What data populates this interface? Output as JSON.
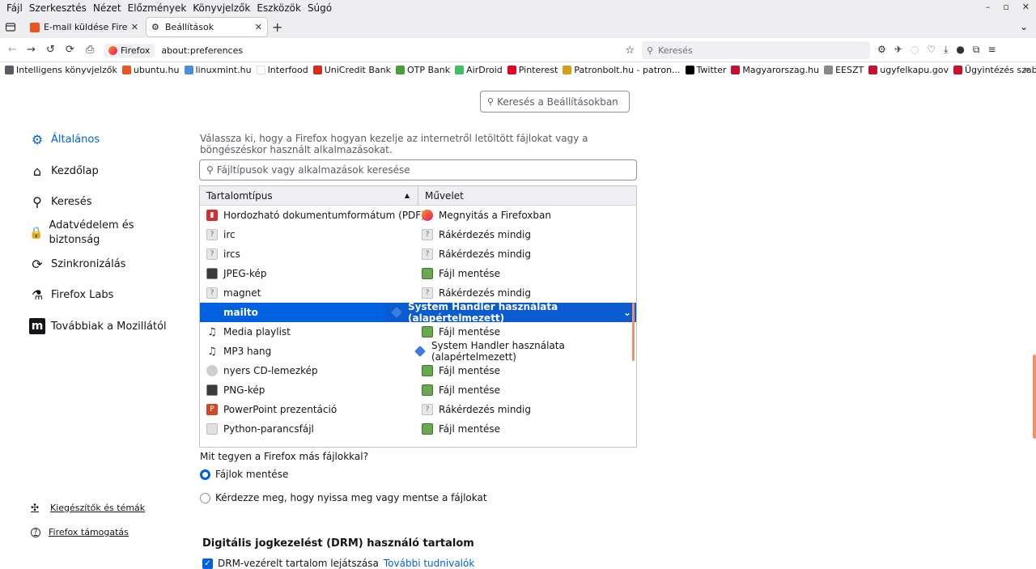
{
  "menu": [
    "Fájl",
    "Szerkesztés",
    "Nézet",
    "Előzmények",
    "Könyvjelzők",
    "Eszközök",
    "Súgó"
  ],
  "window_controls": [
    "–",
    "▫",
    "✕"
  ],
  "tabs": [
    {
      "title": "E-mail küldése Firefoxb",
      "close": "✕",
      "color": "#e8531e"
    },
    {
      "title": "Beállítások",
      "close": "✕",
      "color": "#5b5b66"
    }
  ],
  "newtab": "+",
  "navbar": {
    "identity": "Firefox",
    "url": "about:preferences",
    "search_placeholder": "Keresés"
  },
  "bookmarks": [
    {
      "label": "Intelligens könyvjelzők",
      "color": "#5b5b66"
    },
    {
      "label": "ubuntu.hu",
      "color": "#e95420"
    },
    {
      "label": "linuxmint.hu",
      "color": "#4a90d9"
    },
    {
      "label": "Interfood",
      "color": "#ffffff"
    },
    {
      "label": "UniCredit Bank",
      "color": "#d52b1e"
    },
    {
      "label": "OTP Bank",
      "color": "#4a9e3a"
    },
    {
      "label": "AirDroid",
      "color": "#3fbf5f"
    },
    {
      "label": "Pinterest",
      "color": "#e60023"
    },
    {
      "label": "Patronbolt.hu - patron...",
      "color": "#d4a017"
    },
    {
      "label": "Twitter",
      "color": "#000000"
    },
    {
      "label": "Magyarorszag.hu",
      "color": "#c8102e"
    },
    {
      "label": "EESZT",
      "color": "#888888"
    },
    {
      "label": "ugyfelkapu.gov",
      "color": "#c8102e"
    },
    {
      "label": "Ügyintézés szabadon",
      "color": "#c8102e"
    }
  ],
  "pref_search_placeholder": "Keresés a Beállításokban",
  "sidebar": {
    "items": [
      {
        "label": "Általános",
        "icon": "gear-icon",
        "glyph": "⚙"
      },
      {
        "label": "Kezdőlap",
        "icon": "home-icon",
        "glyph": "⌂"
      },
      {
        "label": "Keresés",
        "icon": "search-icon",
        "glyph": "⚲"
      },
      {
        "label": "Adatvédelem és biztonság",
        "icon": "lock-icon",
        "glyph": "🔒"
      },
      {
        "label": "Szinkronizálás",
        "icon": "sync-icon",
        "glyph": "⟳"
      },
      {
        "label": "Firefox Labs",
        "icon": "labs-icon",
        "glyph": "⚗"
      },
      {
        "label": "Továbbiak a Mozillától",
        "icon": "mozilla-icon",
        "glyph": "m"
      }
    ],
    "footer": [
      {
        "label": "Kiegészítők és témák",
        "icon": "puzzle-icon",
        "glyph": "✣"
      },
      {
        "label": "Firefox támogatás",
        "icon": "help-icon",
        "glyph": "?"
      }
    ]
  },
  "applications": {
    "description": "Válassza ki, hogy a Firefox hogyan kezelje az internetről letöltött fájlokat vagy a böngészéskor használt alkalmazásokat.",
    "filter_placeholder": "Fájltípusok vagy alkalmazások keresése",
    "columns": [
      "Tartalomtípus",
      "Művelet"
    ],
    "sort_indicator": "▲",
    "rows": [
      {
        "type": "Hordozható dokumentumformátum (PDF)",
        "icon": "pdf",
        "action": "Megnyitás a Firefoxban",
        "action_icon": "ff"
      },
      {
        "type": "irc",
        "icon": "doc",
        "action": "Rákérdezés mindig",
        "action_icon": "doc"
      },
      {
        "type": "ircs",
        "icon": "doc",
        "action": "Rákérdezés mindig",
        "action_icon": "doc"
      },
      {
        "type": "JPEG-kép",
        "icon": "img",
        "action": "Fájl mentése",
        "action_icon": "save"
      },
      {
        "type": "magnet",
        "icon": "doc",
        "action": "Rákérdezés mindig",
        "action_icon": "doc"
      },
      {
        "type": "mailto",
        "icon": "none",
        "action": "System Handler használata (alapértelmezett)",
        "action_icon": "sys",
        "selected": true
      },
      {
        "type": "Media playlist",
        "icon": "audio",
        "action": "Fájl mentése",
        "action_icon": "save"
      },
      {
        "type": "MP3 hang",
        "icon": "audio",
        "action": "System Handler használata (alapértelmezett)",
        "action_icon": "sys"
      },
      {
        "type": "nyers CD-lemezkép",
        "icon": "cd",
        "action": "Fájl mentése",
        "action_icon": "save"
      },
      {
        "type": "PNG-kép",
        "icon": "img",
        "action": "Fájl mentése",
        "action_icon": "save"
      },
      {
        "type": "PowerPoint prezentáció",
        "icon": "ppt",
        "action": "Rákérdezés mindig",
        "action_icon": "doc"
      },
      {
        "type": "Python-parancsfájl",
        "icon": "py",
        "action": "Fájl mentése",
        "action_icon": "save"
      }
    ],
    "other_files_question": "Mit tegyen a Firefox más fájlokkal?",
    "options": [
      {
        "label": "Fájlok mentése",
        "checked": true
      },
      {
        "label": "Kérdezze meg, hogy nyissa meg vagy mentse a fájlokat",
        "checked": false
      }
    ]
  },
  "drm": {
    "heading": "Digitális jogkezelést (DRM) használó tartalom",
    "checkbox_label": "DRM-vezérelt tartalom lejátszása",
    "checked": true,
    "learn_more": "További tudnivalók"
  }
}
